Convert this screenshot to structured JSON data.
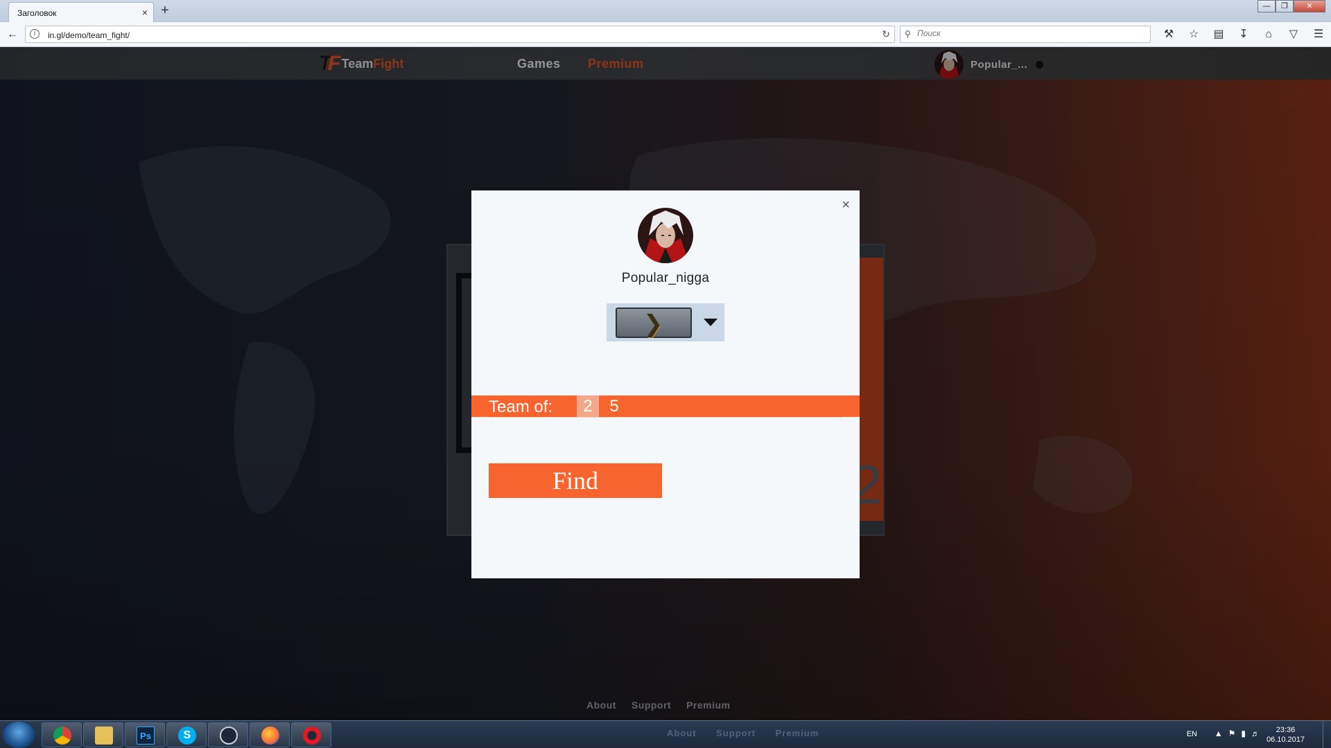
{
  "browser": {
    "tab_title": "Заголовок",
    "tab_close": "×",
    "new_tab": "+",
    "url": "in.gl/demo/team_fight/",
    "search_placeholder": "Поиск",
    "window_min": "—",
    "window_max": "❐",
    "window_close": "✕"
  },
  "site": {
    "logo_mark": "TF",
    "logo_team": "Team",
    "logo_fight": "Fight",
    "nav": {
      "games": "Games",
      "premium": "Premium"
    },
    "user": {
      "name": "Popular_..."
    },
    "footer": {
      "about": "About",
      "support": "Support",
      "premium": "Premium"
    },
    "hero_digit": "2"
  },
  "modal": {
    "close": "×",
    "username": "Popular_nigga",
    "team_label": "Team of:",
    "team_options": [
      "2",
      "5"
    ],
    "team_selected": "2",
    "find_label": "Find",
    "rank_chevron": "❯"
  },
  "taskbar": {
    "apps": [
      "chrome",
      "explorer",
      "photoshop",
      "skype",
      "steam",
      "firefox",
      "opera"
    ],
    "ps_label": "Ps",
    "skype_label": "S",
    "lang": "EN",
    "time": "23:36",
    "date": "06.10.2017",
    "ghost": {
      "about": "About",
      "support": "Support",
      "premium": "Premium"
    }
  },
  "colors": {
    "accent": "#f7642d",
    "brand_orange": "#e0562b",
    "modal_bg": "#f5f8fb"
  }
}
